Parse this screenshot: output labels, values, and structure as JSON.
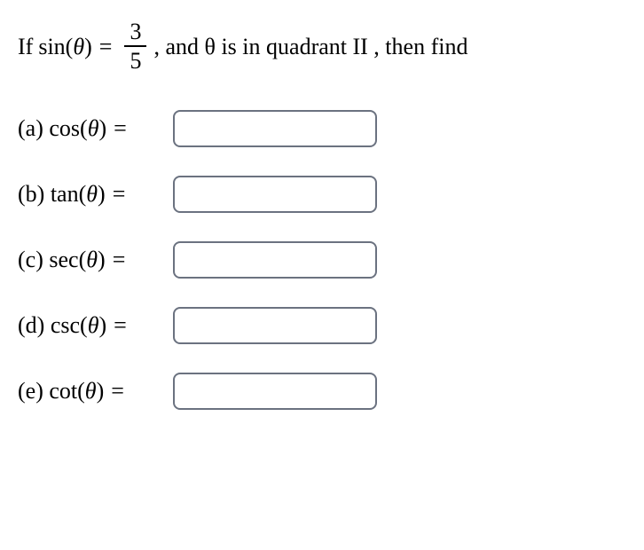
{
  "problem": {
    "if_text": "If",
    "given_func": "sin",
    "given_arg": "θ",
    "equals": "=",
    "fraction_num": "3",
    "fraction_den": "5",
    "after_text": ", and θ is in quadrant II , then find"
  },
  "parts": [
    {
      "letter": "(a)",
      "func": "cos",
      "arg": "θ",
      "equals": "=",
      "value": ""
    },
    {
      "letter": "(b)",
      "func": "tan",
      "arg": "θ",
      "equals": "=",
      "value": ""
    },
    {
      "letter": "(c)",
      "func": "sec",
      "arg": "θ",
      "equals": "=",
      "value": ""
    },
    {
      "letter": "(d)",
      "func": "csc",
      "arg": "θ",
      "equals": "=",
      "value": ""
    },
    {
      "letter": "(e)",
      "func": "cot",
      "arg": "θ",
      "equals": "=",
      "value": ""
    }
  ]
}
